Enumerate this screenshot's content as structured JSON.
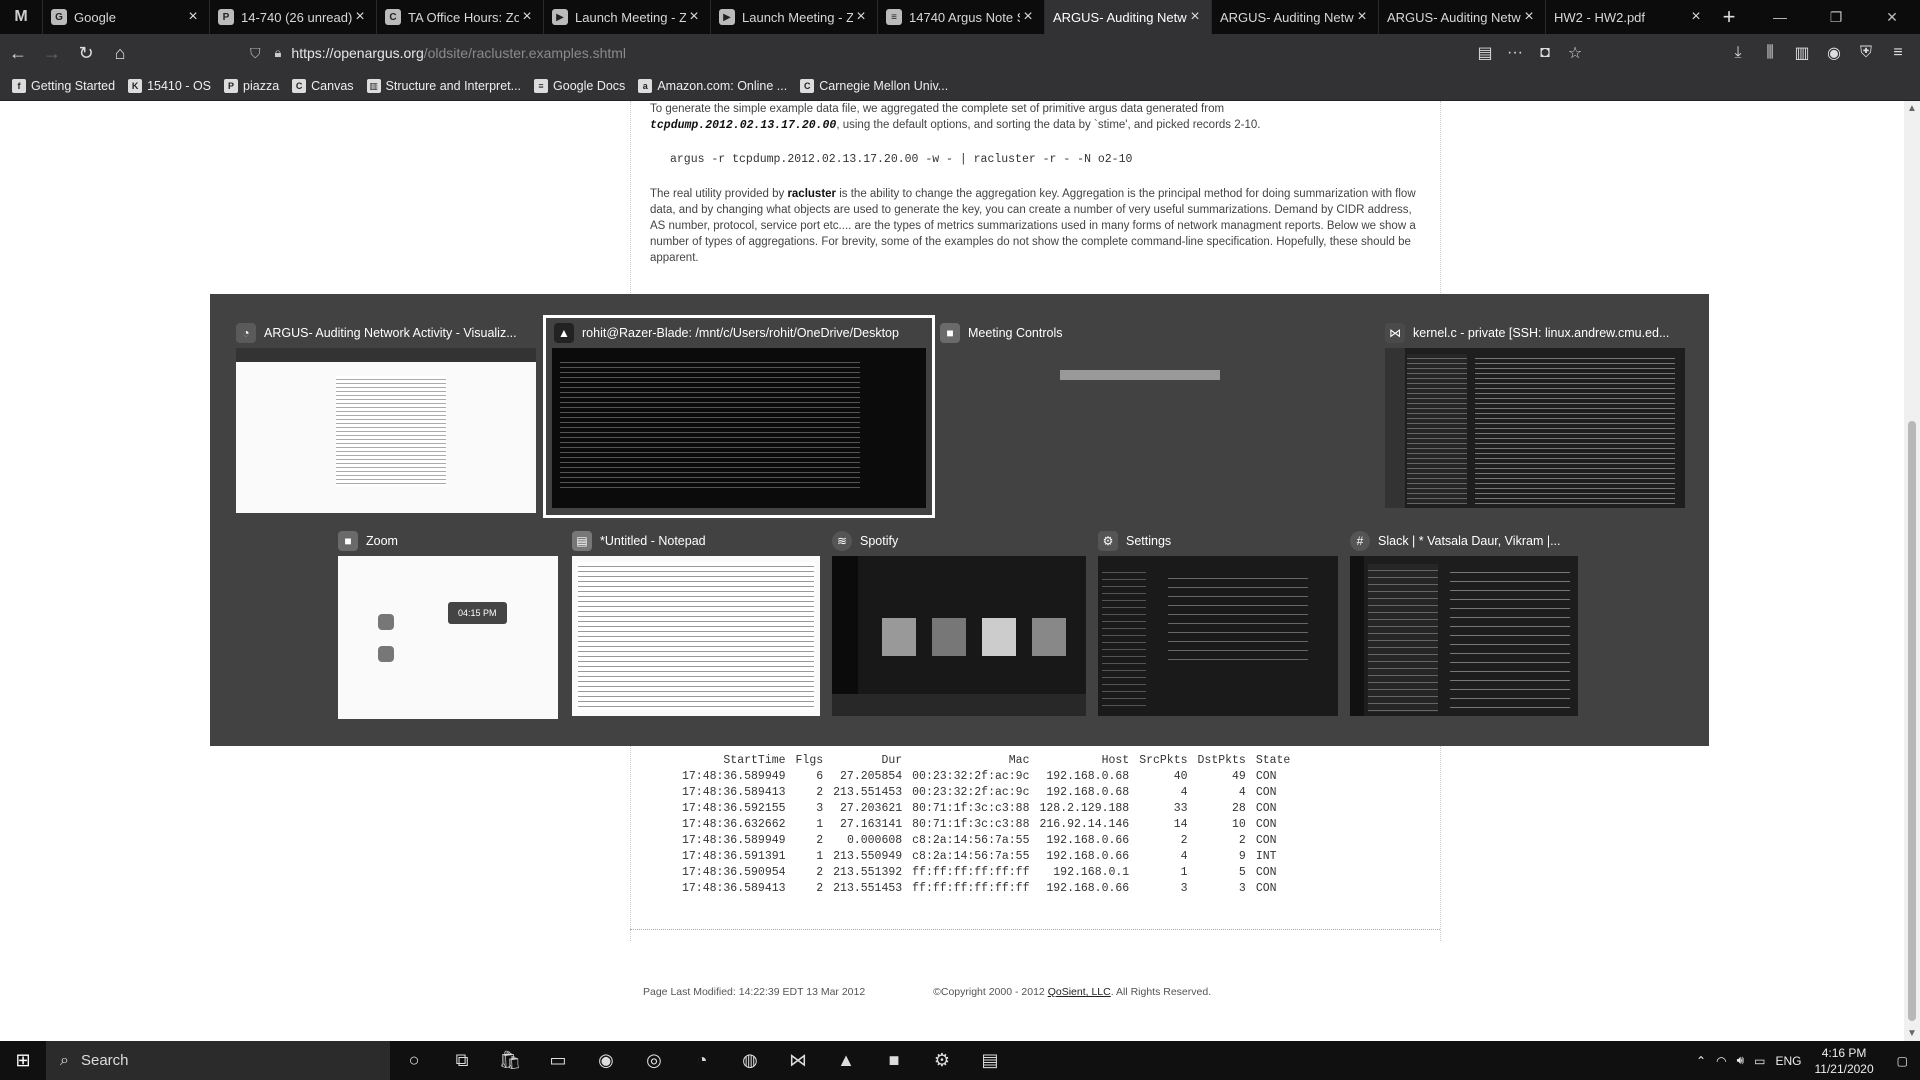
{
  "browser": {
    "tabs": [
      {
        "label": "Google",
        "icon": "google-icon",
        "active": false
      },
      {
        "label": "14-740 (26 unread)",
        "icon": "piazza-icon",
        "active": false
      },
      {
        "label": "TA Office Hours: Zo",
        "icon": "canvas-icon",
        "active": false
      },
      {
        "label": "Launch Meeting - Z",
        "icon": "zoom-icon",
        "active": false
      },
      {
        "label": "Launch Meeting - Z",
        "icon": "zoom-icon",
        "active": false
      },
      {
        "label": "14740 Argus Note S",
        "icon": "docs-icon",
        "active": false
      },
      {
        "label": "ARGUS- Auditing Netw",
        "icon": "none",
        "active": true
      },
      {
        "label": "ARGUS- Auditing Netw",
        "icon": "none",
        "active": false
      },
      {
        "label": "ARGUS- Auditing Netw",
        "icon": "none",
        "active": false
      },
      {
        "label": "HW2 - HW2.pdf",
        "icon": "none",
        "active": false
      }
    ],
    "url_host": "https://openargus.org",
    "url_path": "/oldsite/racluster.examples.shtml",
    "bookmarks": [
      {
        "label": "Getting Started",
        "icon": "firefox-icon"
      },
      {
        "label": "15410 - OS",
        "icon": "os-icon"
      },
      {
        "label": "piazza",
        "icon": "piazza-icon"
      },
      {
        "label": "Canvas",
        "icon": "canvas-icon"
      },
      {
        "label": "Structure and Interpret...",
        "icon": "book-icon"
      },
      {
        "label": "Google Docs",
        "icon": "docs-icon"
      },
      {
        "label": "Amazon.com: Online ...",
        "icon": "amazon-icon"
      },
      {
        "label": "Carnegie Mellon Univ...",
        "icon": "cmu-icon"
      }
    ]
  },
  "page": {
    "intro_a": "To generate the simple example data file, we aggregated the complete set of primitive argus data generated from",
    "intro_file": "tcpdump.2012.02.13.17.20.00",
    "intro_b": ", using the default options, and sorting the data by `stime', and picked records 2-10.",
    "command": "argus -r tcpdump.2012.02.13.17.20.00 -w - | racluster -r - -N o2-10",
    "para_a": "The real utility provided by ",
    "para_bold": "racluster",
    "para_b": " is the ability to change the aggregation key. Aggregation is the principal method for doing summarization with flow data, and by changing what objects are used to generate the key, you can create a number of very useful summarizations. Demand by CIDR address, AS number, protocol, service port etc.... are the types of metrics summarizations used in many forms of network managment reports. Below we show a number of types of aggregations. For brevity, some of the examples do not show the complete command-line specification. Hopefully, these should be apparent.",
    "table_header": [
      "StartTime",
      "Flgs",
      "Dur",
      "Mac",
      "Host",
      "SrcPkts",
      "DstPkts",
      "State"
    ],
    "rows": [
      [
        "17:48:36.589949",
        "6",
        "27.205854",
        "00:23:32:2f:ac:9c",
        "192.168.0.68",
        "40",
        "49",
        "CON"
      ],
      [
        "17:48:36.589413",
        "2",
        "213.551453",
        "00:23:32:2f:ac:9c",
        "192.168.0.68",
        "4",
        "4",
        "CON"
      ],
      [
        "17:48:36.592155",
        "3",
        "27.203621",
        "80:71:1f:3c:c3:88",
        "128.2.129.188",
        "33",
        "28",
        "CON"
      ],
      [
        "17:48:36.632662",
        "1",
        "27.163141",
        "80:71:1f:3c:c3:88",
        "216.92.14.146",
        "14",
        "10",
        "CON"
      ],
      [
        "17:48:36.589949",
        "2",
        "0.000608",
        "c8:2a:14:56:7a:55",
        "192.168.0.66",
        "2",
        "2",
        "CON"
      ],
      [
        "17:48:36.591391",
        "1",
        "213.550949",
        "c8:2a:14:56:7a:55",
        "192.168.0.66",
        "4",
        "9",
        "INT"
      ],
      [
        "17:48:36.590954",
        "2",
        "213.551392",
        "ff:ff:ff:ff:ff:ff",
        "192.168.0.1",
        "1",
        "5",
        "CON"
      ],
      [
        "17:48:36.589413",
        "2",
        "213.551453",
        "ff:ff:ff:ff:ff:ff",
        "192.168.0.66",
        "3",
        "3",
        "CON"
      ]
    ],
    "footer_modified": "Page Last Modified: 14:22:39 EDT 13 Mar 2012",
    "footer_copyright": "©Copyright 2000 - 2012 ",
    "footer_company": "QoSient, LLC",
    "footer_rights": ". All Rights Reserved."
  },
  "switcher": {
    "windows": [
      {
        "title": "ARGUS- Auditing Network Activity - Visualiz...",
        "icon": "firefox-icon",
        "color": "#5a5a5a"
      },
      {
        "title": "rohit@Razer-Blade: /mnt/c/Users/rohit/OneDrive/Desktop",
        "icon": "linux-icon",
        "color": "#222222"
      },
      {
        "title": "Meeting Controls",
        "icon": "zoom-icon",
        "color": "#6a6a6a"
      },
      {
        "title": "kernel.c - private [SSH: linux.andrew.cmu.ed...",
        "icon": "vscode-icon",
        "color": "#4a4a4a"
      },
      {
        "title": "Zoom",
        "icon": "zoom-icon",
        "color": "#6a6a6a"
      },
      {
        "title": "*Untitled - Notepad",
        "icon": "notepad-icon",
        "color": "#777777"
      },
      {
        "title": "Spotify",
        "icon": "spotify-icon",
        "color": "#555555"
      },
      {
        "title": "Settings",
        "icon": "gear-icon",
        "color": "#555555"
      },
      {
        "title": "Slack | * Vatsala Daur, Vikram |...",
        "icon": "slack-icon",
        "color": "#555555"
      }
    ],
    "zoom_time": "04:15 PM"
  },
  "taskbar": {
    "search_placeholder": "Search",
    "tray_lang": "ENG",
    "time": "4:16 PM",
    "date": "11/21/2020"
  }
}
